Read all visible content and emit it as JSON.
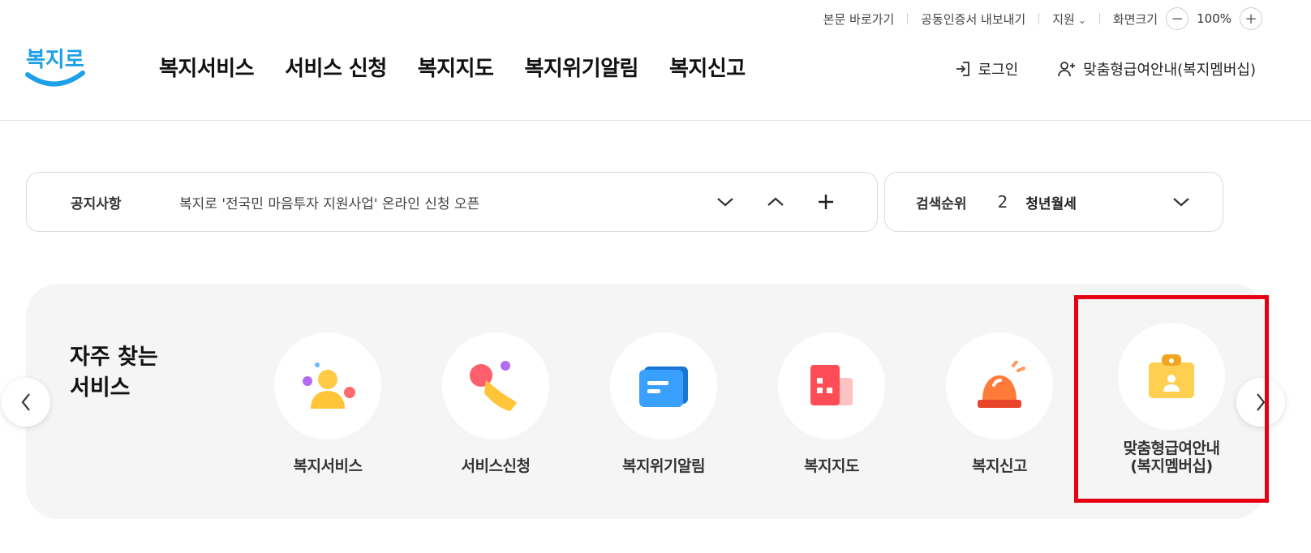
{
  "utility": {
    "skip_link": "본문 바로가기",
    "cert_export": "공동인증서 내보내기",
    "support": "지원",
    "screen_size": "화면크기",
    "zoom_value": "100%",
    "zoom_out": "−",
    "zoom_in": "+"
  },
  "header": {
    "logo_text": "복지로",
    "nav": [
      "복지서비스",
      "서비스 신청",
      "복지지도",
      "복지위기알림",
      "복지신고"
    ],
    "login": "로그인",
    "membership": "맞춤형급여안내(복지멤버십)"
  },
  "notice": {
    "label": "공지사항",
    "text": "복지로 '전국민 마음투자 지원사업' 온라인 신청 오픈"
  },
  "search_rank": {
    "label": "검색순위",
    "rank": "2",
    "term": "청년월세"
  },
  "favorites": {
    "title_line1": "자주 찾는",
    "title_line2": "서비스",
    "items": [
      {
        "label": "복지서비스",
        "icon": "person-icon"
      },
      {
        "label": "서비스신청",
        "icon": "hand-tap-icon"
      },
      {
        "label": "복지위기알림",
        "icon": "message-icon"
      },
      {
        "label": "복지지도",
        "icon": "building-icon"
      },
      {
        "label": "복지신고",
        "icon": "siren-icon"
      },
      {
        "label_line1": "맞춤형급여안내",
        "label_line2": "(복지멤버십)",
        "icon": "id-badge-icon"
      }
    ]
  },
  "colors": {
    "brand_blue": "#1ea0e8",
    "highlight_red": "#e60012",
    "panel_bg": "#f5f5f5"
  }
}
